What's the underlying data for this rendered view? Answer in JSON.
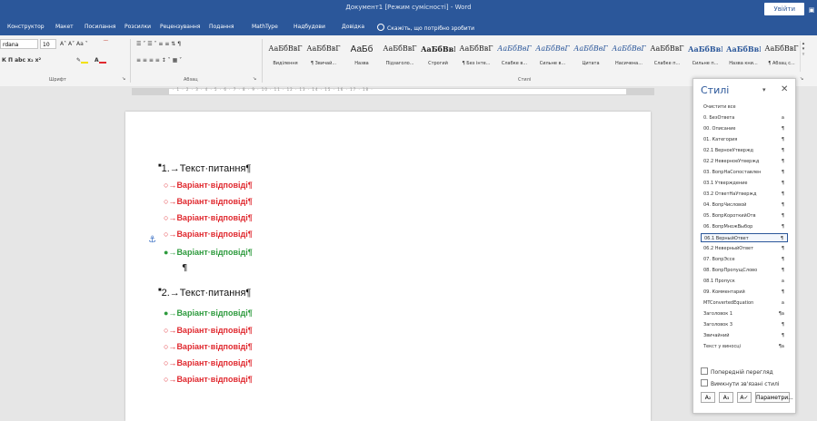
{
  "titlebar": {
    "title": "Документ1 [Режим сумісності] - Word",
    "signin": "Увійти"
  },
  "tabs": [
    {
      "label": "Конструктор"
    },
    {
      "label": "Макет"
    },
    {
      "label": "Посилання"
    },
    {
      "label": "Розсилки"
    },
    {
      "label": "Рецензування"
    },
    {
      "label": "Подання"
    },
    {
      "label": "MathType"
    },
    {
      "label": "Надбудови"
    },
    {
      "label": "Довідка"
    },
    {
      "label": "Скажіть, що потрібно зробити"
    }
  ],
  "ribbon": {
    "font_name": "rdana",
    "font_size": "10",
    "group_font": "Шрифт",
    "group_paragraph": "Абзац",
    "group_styles": "Стилі",
    "fmt_row1": "A˄ A˅  Aa ˅",
    "fmt_row2": "К  П  abc  x₂  x²",
    "para_row1": "☰ ˅  ☰ ˅  ≡  ≡  ⇅  ¶",
    "para_row2": "≡  ≡  ≡  ≡  ↕ ˅  ▦ ˅",
    "highlight_color": "#f2e000",
    "fontcolor_color": "#e0292f",
    "gallery": [
      {
        "sample": "АаБбВвГ",
        "name": "Виділення"
      },
      {
        "sample": "АаБбВвГ",
        "name": "¶ Звичай..."
      },
      {
        "sample": "АаБб",
        "name": "Назва"
      },
      {
        "sample": "АаБбВвГ",
        "name": "Підзаголо..."
      },
      {
        "sample": "АаБбВвГ",
        "name": "Строгий"
      },
      {
        "sample": "АаБбВвГ",
        "name": "¶ Без інте..."
      },
      {
        "sample": "АаБбВвГ",
        "name": "Слабке в..."
      },
      {
        "sample": "АаБбВвГ",
        "name": "Сильне в..."
      },
      {
        "sample": "АаБбВвГ",
        "name": "Цитата"
      },
      {
        "sample": "АаБбВвГ",
        "name": "Насичена..."
      },
      {
        "sample": "АаБбВвГ",
        "name": "Слабке п..."
      },
      {
        "sample": "АаБбВвГ",
        "name": "Сильне п..."
      },
      {
        "sample": "АаБбВвГ",
        "name": "Назва кни..."
      },
      {
        "sample": "АаБбВвГ",
        "name": "¶ Абзац с..."
      }
    ]
  },
  "ruler": {
    "numbers": "· 1 · 2 · 3 · 4 · 5 · 6 · 7 · 8 · 9 · 10 · 11 · 12 · 13 · 14 · 15 · 16 · 17 · 18 ·"
  },
  "document": {
    "questions": [
      {
        "label": "1.→Текст·питання¶",
        "answers": [
          {
            "bullet": "○→",
            "text": "Варіант·відповіді¶",
            "color": "red"
          },
          {
            "bullet": "○→",
            "text": "Варіант·відповіді¶",
            "color": "red"
          },
          {
            "bullet": "○→",
            "text": "Варіант·відповіді¶",
            "color": "red"
          },
          {
            "bullet": "○→",
            "text": "Варіант·відповіді¶",
            "color": "red"
          },
          {
            "bullet": "●→",
            "text": "Варіант·відповіді¶",
            "color": "green"
          }
        ]
      },
      {
        "label": "2.→Текст·питання¶",
        "answers": [
          {
            "bullet": "●→",
            "text": "Варіант·відповіді¶",
            "color": "green"
          },
          {
            "bullet": "○→",
            "text": "Варіант·відповіді¶",
            "color": "red"
          },
          {
            "bullet": "○→",
            "text": "Варіант·відповіді¶",
            "color": "red"
          },
          {
            "bullet": "○→",
            "text": "Варіант·відповіді¶",
            "color": "red"
          },
          {
            "bullet": "○→",
            "text": "Варіант·відповіді¶",
            "color": "red"
          }
        ]
      }
    ],
    "empty_pilcrow": "¶",
    "anchor_glyph": "⚓"
  },
  "styles_pane": {
    "title": "Стилі",
    "items": [
      {
        "name": "Очистити все",
        "mark": ""
      },
      {
        "name": "0. БезОтвета",
        "mark": "a"
      },
      {
        "name": "00. Описание",
        "mark": "¶"
      },
      {
        "name": "01. Категория",
        "mark": "¶"
      },
      {
        "name": "02.1 ВерноеУтвержд",
        "mark": "¶"
      },
      {
        "name": "02.2 НеверноеУтвержд",
        "mark": "¶"
      },
      {
        "name": "03. ВопрНаСопоставлен",
        "mark": "¶"
      },
      {
        "name": "03.1 Утверждение",
        "mark": "¶"
      },
      {
        "name": "03.2 ОтветНаУтвержд",
        "mark": "¶"
      },
      {
        "name": "04. ВопрЧисловой",
        "mark": "¶"
      },
      {
        "name": "05. ВопрКороткийОтв",
        "mark": "¶"
      },
      {
        "name": "06. ВопрМножВыбор",
        "mark": "¶"
      },
      {
        "name": "06.1 ВерныйОтвет",
        "mark": "¶",
        "selected": true
      },
      {
        "name": "06.2 НеверныйОтвет",
        "mark": "¶"
      },
      {
        "name": "07. ВопрЭссе",
        "mark": "¶"
      },
      {
        "name": "08. ВопрПропущСлово",
        "mark": "¶"
      },
      {
        "name": "08.1 Пропуск",
        "mark": "a"
      },
      {
        "name": "09. Комментарий",
        "mark": "¶"
      },
      {
        "name": "MTConvertedEquation",
        "mark": "a"
      },
      {
        "name": "Заголовок 1",
        "mark": "¶a"
      },
      {
        "name": "Заголовок 3",
        "mark": "¶"
      },
      {
        "name": "Звичайний",
        "mark": "¶"
      },
      {
        "name": "Текст у виносці",
        "mark": "¶a"
      }
    ],
    "opt_preview": "Попередній перегляд",
    "opt_disable_linked": "Вимкнути зв'язані стилі",
    "btn_params": "Параметри..."
  }
}
